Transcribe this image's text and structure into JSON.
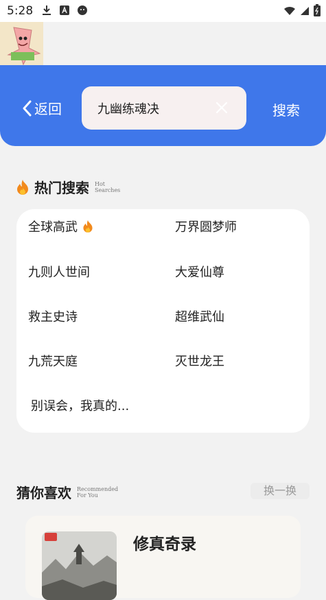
{
  "status_bar": {
    "time": "5:28",
    "icons": [
      "download-icon",
      "app-a-icon",
      "android-icon",
      "wifi-icon",
      "signal-icon",
      "battery-icon"
    ]
  },
  "header": {
    "back_label": "返回",
    "search_value": "九幽练魂决",
    "search_button_label": "搜索",
    "accent_color": "#3f77ea"
  },
  "hot": {
    "title": "热门搜索",
    "subtitle": "Hot Searches",
    "items": [
      {
        "label": "全球高武"
      },
      {
        "label": "万界圆梦师"
      },
      {
        "label": "九则人世间"
      },
      {
        "label": "大爱仙尊"
      },
      {
        "label": "救主史诗"
      },
      {
        "label": "超维武仙"
      },
      {
        "label": "九荒天庭"
      },
      {
        "label": "灭世龙王"
      },
      {
        "label": "别误会，我真的..."
      }
    ]
  },
  "recommend": {
    "title": "猜你喜欢",
    "subtitle": "Recommended For You",
    "refresh_label": "换一换",
    "books": [
      {
        "name": "修真奇录"
      }
    ]
  }
}
